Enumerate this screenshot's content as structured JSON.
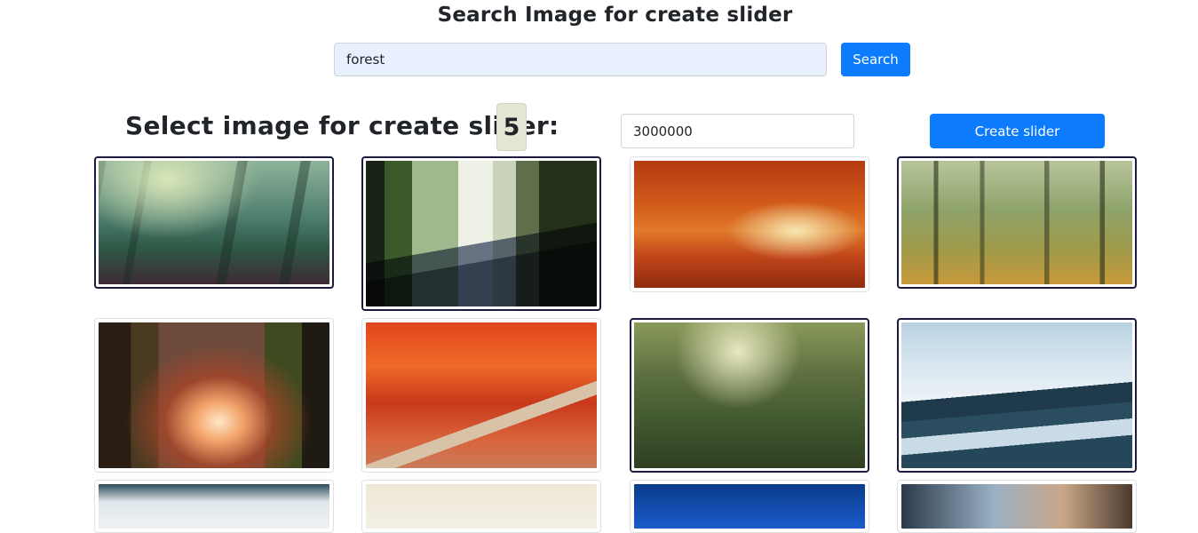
{
  "header": {
    "title": "Search Image for create slider"
  },
  "search": {
    "value": "forest",
    "button_label": "Search"
  },
  "selection": {
    "label": "Select image for create slider:",
    "selected_count": "5",
    "duration_value": "3000000",
    "create_label": "Create slider"
  },
  "gallery": {
    "images": [
      {
        "subject": "misty green forest",
        "selected": true
      },
      {
        "subject": "sunlit forest road",
        "selected": true
      },
      {
        "subject": "autumn orange forest path",
        "selected": false
      },
      {
        "subject": "sunny green woodland",
        "selected": true
      },
      {
        "subject": "glowing forest path between trees",
        "selected": false
      },
      {
        "subject": "red autumn trees with winding path",
        "selected": false
      },
      {
        "subject": "mossy forest trail",
        "selected": true
      },
      {
        "subject": "foggy blue pine forest",
        "selected": true
      },
      {
        "subject": "misty landscape",
        "selected": false
      },
      {
        "subject": "pale forest",
        "selected": false
      },
      {
        "subject": "blue forest",
        "selected": false
      },
      {
        "subject": "sunset forest",
        "selected": false
      }
    ]
  }
}
